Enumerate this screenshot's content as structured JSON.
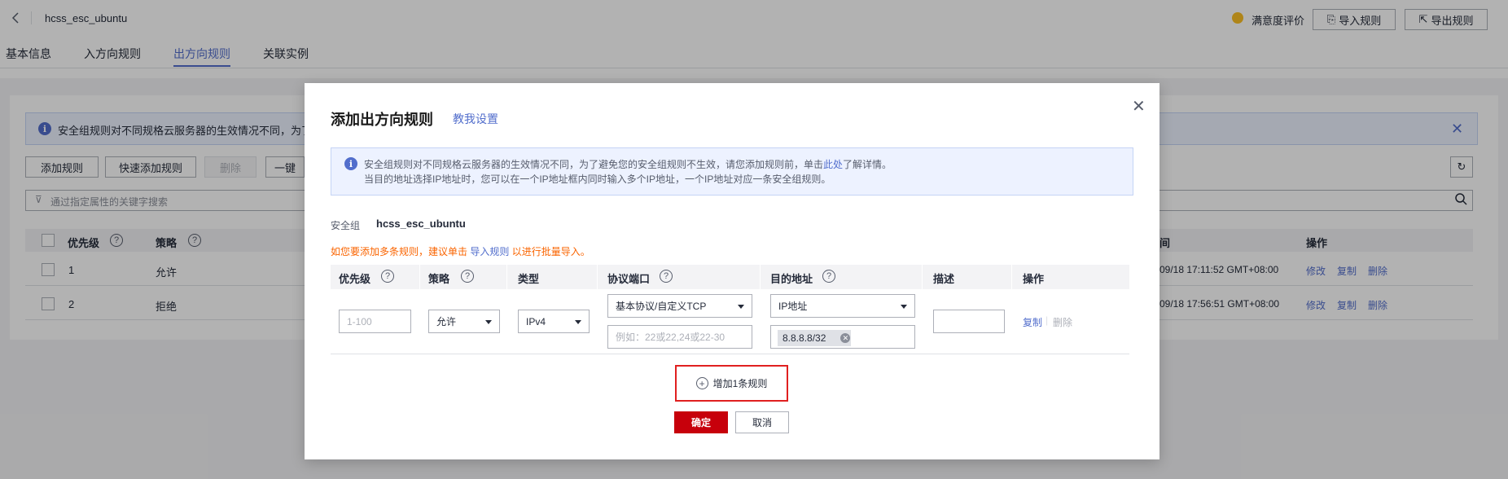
{
  "header": {
    "title": "hcss_esc_ubuntu",
    "satisfaction": "满意度评价",
    "import_rules": "导入规则",
    "export_rules": "导出规则"
  },
  "tabs": [
    {
      "label": "基本信息"
    },
    {
      "label": "入方向规则"
    },
    {
      "label": "出方向规则",
      "active": true
    },
    {
      "label": "关联实例"
    }
  ],
  "page": {
    "info": "安全组规则对不同规格云服务器的生效情况不同，为了避",
    "buttons": {
      "add": "添加规则",
      "quick_add": "快速添加规则",
      "delete": "删除",
      "one_click": "一键"
    },
    "filter_placeholder": "通过指定属性的关键字搜索",
    "columns": {
      "priority": "优先级",
      "policy": "策略",
      "time": "间",
      "ops": "操作"
    },
    "rows": [
      {
        "priority": "1",
        "policy": "允许",
        "time": "09/18 17:11:52 GMT+08:00",
        "modify": "修改",
        "copy": "复制",
        "delete": "删除"
      },
      {
        "priority": "2",
        "policy": "拒绝",
        "time": "09/18 17:56:51 GMT+08:00",
        "modify": "修改",
        "copy": "复制",
        "delete": "删除"
      }
    ]
  },
  "modal": {
    "title": "添加出方向规则",
    "teach": "教我设置",
    "info_line1_a": "安全组规则对不同规格云服务器的生效情况不同，为了避免您的安全组规则不生效，请您添加规则前，单击",
    "info_line1_link": "此处",
    "info_line1_b": "了解详情。",
    "info_line2": "当目的地址选择IP地址时，您可以在一个IP地址框内同时输入多个IP地址，一个IP地址对应一条安全组规则。",
    "sg_label": "安全组",
    "sg_value": "hcss_esc_ubuntu",
    "tip_a": "如您要添加多条规则，建议单击",
    "tip_link": "导入规则",
    "tip_b": "以进行批量导入。",
    "columns": {
      "priority": "优先级",
      "policy": "策略",
      "type": "类型",
      "port": "协议端口",
      "dest": "目的地址",
      "desc": "描述",
      "ops": "操作"
    },
    "row": {
      "priority_placeholder": "1-100",
      "policy": "允许",
      "type": "IPv4",
      "protocol": "基本协议/自定义TCP",
      "port_placeholder": "例如：22或22,24或22-30",
      "dest_type": "IP地址",
      "dest_ip": "8.8.8.8/32",
      "copy": "复制",
      "delete": "删除"
    },
    "add_rule": "增加1条规则",
    "confirm": "确定",
    "cancel": "取消"
  }
}
